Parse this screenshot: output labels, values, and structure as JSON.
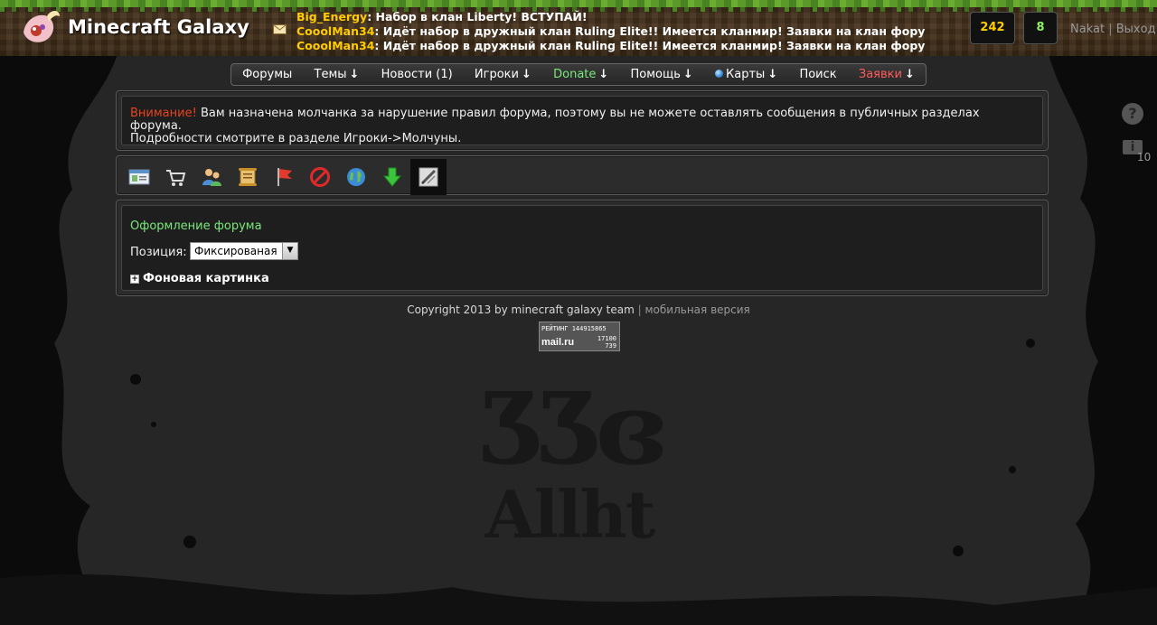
{
  "header": {
    "site_title": "Minecraft Galaxy",
    "logo_icon": "minecraft-galaxy-logo",
    "shoutbox_icon": "envelope-icon",
    "shouts": [
      {
        "user": "Big_Energy",
        "text": ": Набор в клан Liberty! ВСТУПАЙ!"
      },
      {
        "user": "CooolMan34",
        "text": ": Идёт набор в дружный клан Ruling Elite!! Имеется кланмир! Заявки на клан фору"
      },
      {
        "user": "CooolMan34",
        "text": ": Идёт набор в дружный клан Ruling Elite!! Имеется кланмир! Заявки на клан фору"
      }
    ],
    "counter_1": "242",
    "counter_2": "8",
    "username": "Nakat",
    "separator": "|",
    "logout": "Выход",
    "colors": {
      "accent_yellow": "#ffcc00",
      "accent_green": "#8bf063"
    }
  },
  "nav": {
    "items": [
      {
        "label": "Форумы",
        "arrow": ""
      },
      {
        "label": "Темы",
        "arrow": "↓"
      },
      {
        "label": "Новости (1)",
        "arrow": ""
      },
      {
        "label": "Игроки",
        "arrow": "↓"
      },
      {
        "label": "Donate",
        "arrow": "↓"
      },
      {
        "label": "Помощь",
        "arrow": "↓"
      },
      {
        "label": "Карты",
        "arrow": "↓"
      },
      {
        "label": "Поиск",
        "arrow": ""
      },
      {
        "label": "Заявки",
        "arrow": "↓"
      }
    ]
  },
  "notice": {
    "label": "Внимание!",
    "text": " Вам назначена молчанка за нарушение правил форума, поэтому вы не можете оставлять сообщения в публичных разделах форума.",
    "text2": "Подробности смотрите в разделе Игроки->Молчуны."
  },
  "toolbar": {
    "tools": [
      "profile-card-icon",
      "cart-icon",
      "users-icon",
      "scroll-icon",
      "flag-icon",
      "ban-icon",
      "globe-icon",
      "download-arrow-icon",
      "brush-icon"
    ]
  },
  "settings": {
    "title": "Оформление форума",
    "position_label": "Позиция:",
    "position_value": "Фиксированая",
    "background_toggle": "Фоновая картинка"
  },
  "footer": {
    "copyright": "Copyright 2013 by minecraft galaxy team",
    "separator": "|",
    "mobile_link": "мобильная версия",
    "counter_title": "РЕЙТИНГ 144915865",
    "counter_brand": "mail.ru",
    "counter_n2": "17100",
    "counter_n3": "739"
  },
  "side": {
    "help": "?",
    "info": "i",
    "info_count": "10"
  }
}
